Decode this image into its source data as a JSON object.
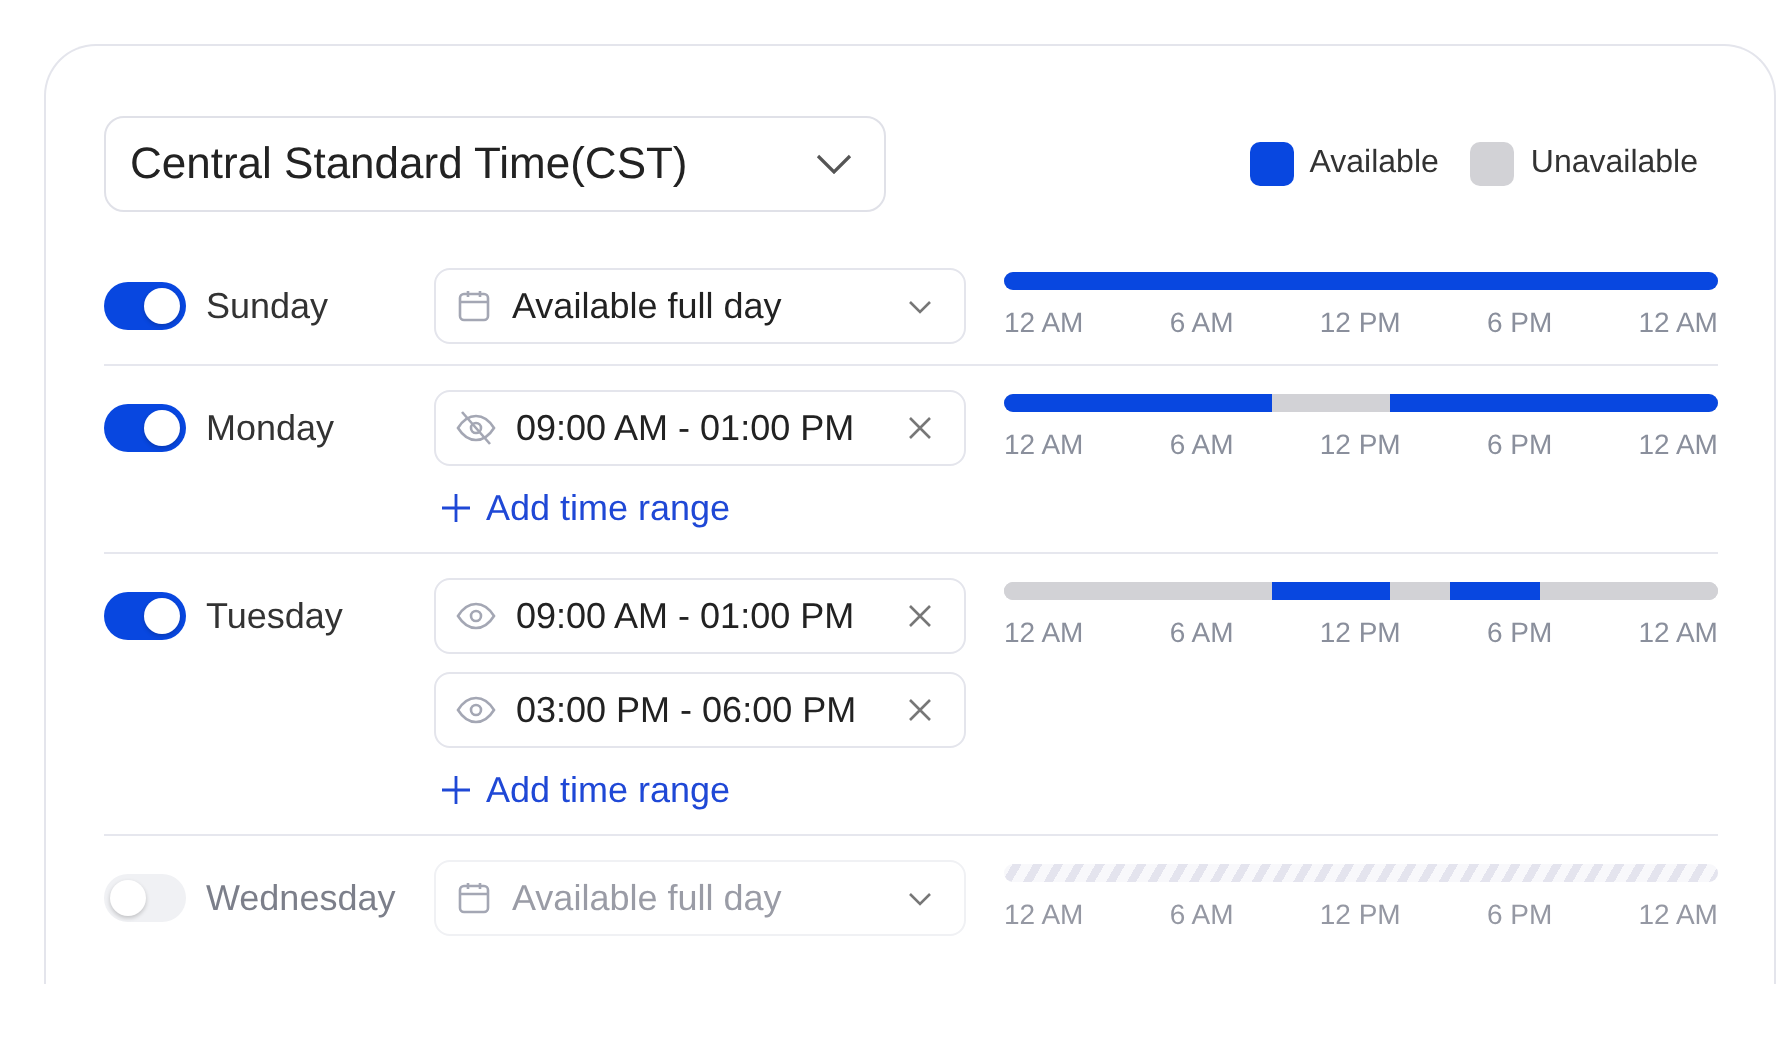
{
  "timezone": {
    "value": "Central Standard Time(CST)"
  },
  "legend": [
    {
      "label": "Available",
      "color": "#0847e0"
    },
    {
      "label": "Unavailable",
      "color": "#d2d2d6"
    }
  ],
  "days": [
    {
      "name": "Sunday",
      "on": true,
      "kind": "full_day",
      "option": "Available full day",
      "ticks": [
        "12 AM",
        "6 AM",
        "12 PM",
        "6 PM",
        "12 AM"
      ]
    },
    {
      "name": "Monday",
      "on": true,
      "kind": "ranges",
      "ranges": [
        {
          "time": "09:00 AM - 01:00 PM",
          "visible": false
        }
      ],
      "add_label": "Add time range",
      "ticks": [
        "12 AM",
        "6 AM",
        "12 PM",
        "6 PM",
        "12 AM"
      ]
    },
    {
      "name": "Tuesday",
      "on": true,
      "kind": "ranges",
      "ranges": [
        {
          "time": "09:00 AM - 01:00 PM",
          "visible": true
        },
        {
          "time": "03:00 PM - 06:00 PM",
          "visible": true
        }
      ],
      "add_label": "Add time range",
      "ticks": [
        "12 AM",
        "6 AM",
        "12 PM",
        "6 PM",
        "12 AM"
      ]
    },
    {
      "name": "Wednesday",
      "on": false,
      "kind": "full_day",
      "option": "Available full day",
      "ticks": [
        "12 AM",
        "6 AM",
        "12 PM",
        "6 PM",
        "12 AM"
      ]
    }
  ]
}
